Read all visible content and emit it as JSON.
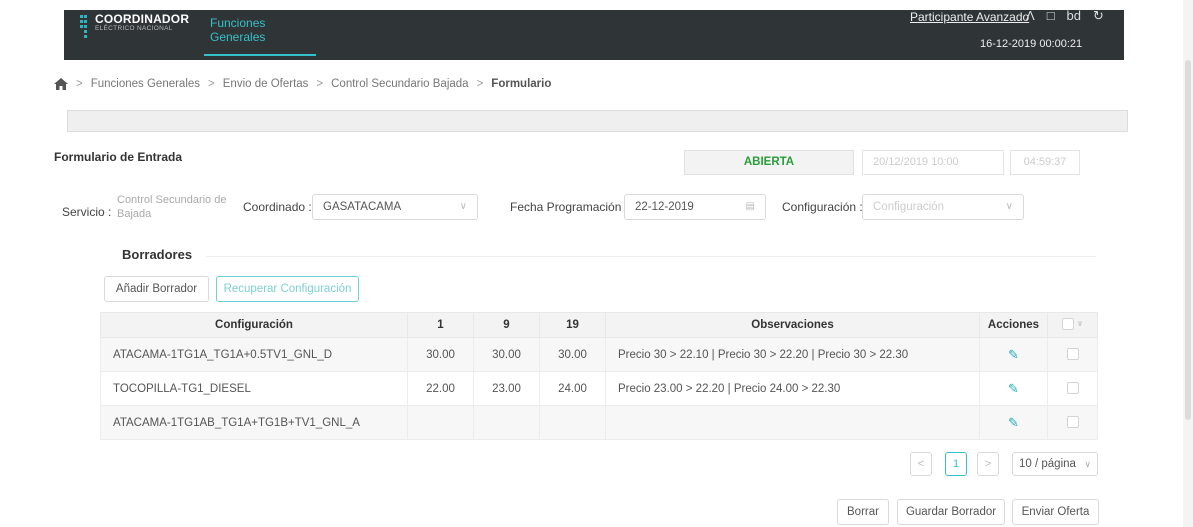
{
  "header": {
    "logo_title": "COORDINADOR",
    "logo_subtitle": "ELÉCTRICO NACIONAL",
    "nav_tab": "Funciones Generales",
    "user": "Participante Avanzado",
    "clock": "16-12-2019  00:00:21",
    "icons": [
      "user-icon",
      "bell-icon",
      "language-icon",
      "logout-icon"
    ]
  },
  "breadcrumb": {
    "items": [
      "Funciones Generales",
      "Envio de Ofertas",
      "Control Secundario Bajada"
    ],
    "current": "Formulario",
    "separator": ">"
  },
  "form": {
    "title": "Formulario de Entrada",
    "status": "ABIERTA",
    "close_date": "20/12/2019    10:00",
    "timer": "04:59:37"
  },
  "filters": {
    "service_label": "Servicio :",
    "service_value": "Control Secundario de Bajada",
    "coordinado_label": "Coordinado :",
    "coordinado_value": "GASATACAMA",
    "fecha_label": "Fecha Programación :",
    "fecha_value": "22-12-2019",
    "config_label": "Configuración :",
    "config_placeholder": "Configuración"
  },
  "drafts": {
    "title": "Borradores",
    "add_button": "Añadir Borrador",
    "recover_button": "Recuperar Configuración"
  },
  "table": {
    "headers": [
      "Configuración",
      "1",
      "9",
      "19",
      "Observaciones",
      "Acciones"
    ],
    "rows": [
      {
        "config": "ATACAMA-1TG1A_TG1A+0.5TV1_GNL_D",
        "h1": "30.00",
        "h9": "30.00",
        "h19": "30.00",
        "obs": "Precio 30 > 22.10 | Precio 30 > 22.20 | Precio 30 > 22.30"
      },
      {
        "config": "TOCOPILLA-TG1_DIESEL",
        "h1": "22.00",
        "h9": "23.00",
        "h19": "24.00",
        "obs": "Precio 23.00 > 22.20 | Precio 24.00 > 22.30"
      },
      {
        "config": "ATACAMA-1TG1AB_TG1A+TG1B+TV1_GNL_A",
        "h1": "",
        "h9": "",
        "h19": "",
        "obs": ""
      }
    ]
  },
  "pagination": {
    "prev": "<",
    "page": "1",
    "next": ">",
    "page_size": "10 / página"
  },
  "actions": {
    "delete": "Borrar",
    "save_draft": "Guardar Borrador",
    "send_offer": "Enviar Oferta"
  },
  "colors": {
    "topbar": "#2f3436",
    "accent": "#35c1c9",
    "status_green": "#2a9d3a"
  }
}
